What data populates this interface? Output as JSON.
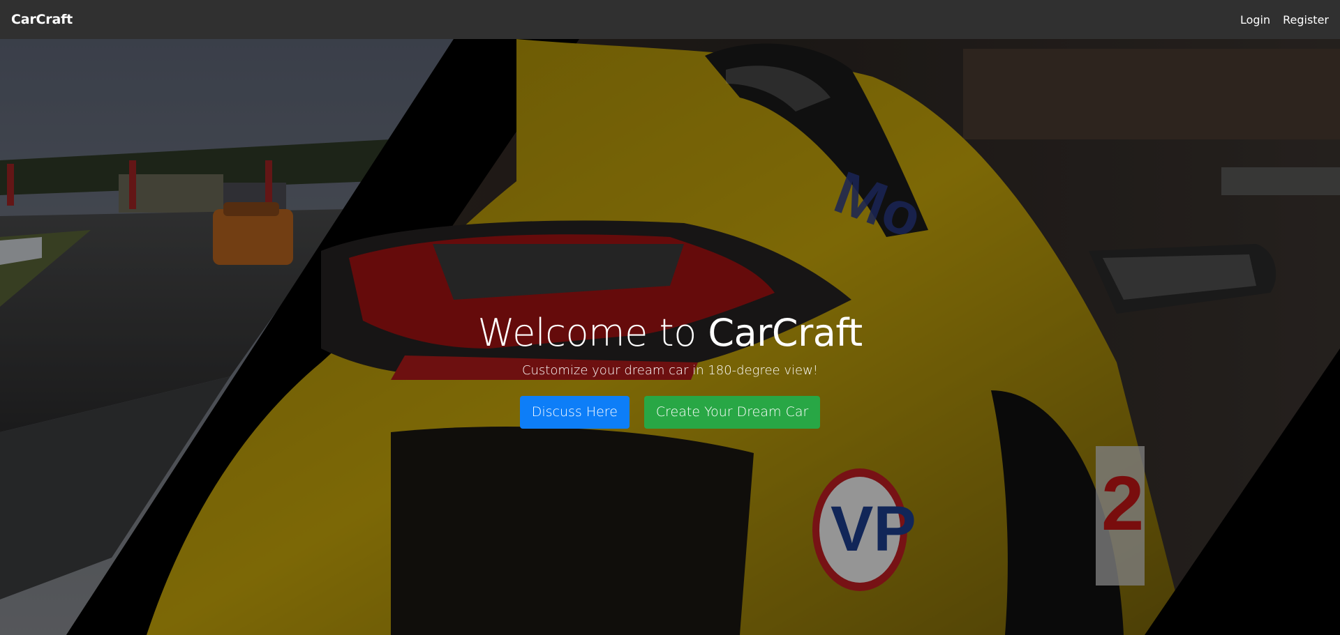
{
  "navbar": {
    "brand": "CarCraft",
    "links": [
      {
        "label": "Login"
      },
      {
        "label": "Register"
      }
    ]
  },
  "hero": {
    "title_prefix": "Welcome to ",
    "title_brand": "CarCraft",
    "subtitle": "Customize your dream car in 180-degree view!",
    "buttons": [
      {
        "label": "Discuss Here",
        "color": "#0d7ef8"
      },
      {
        "label": "Create Your Dream Car",
        "color": "#28a745"
      }
    ]
  },
  "background": {
    "description_icon": "race-car-hero-image",
    "car_color": "#d8b50a",
    "taillight_color": "#c41616"
  }
}
